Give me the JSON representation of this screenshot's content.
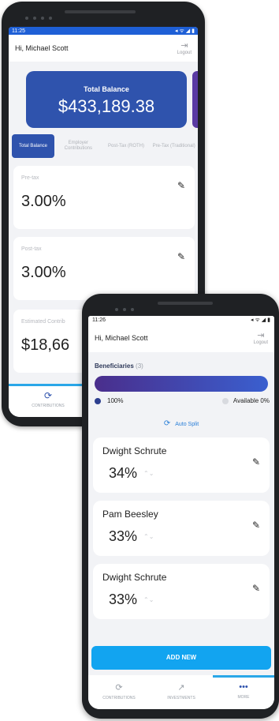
{
  "phone1": {
    "status_time": "11:25",
    "status_icons": "◂ ᯤ ◢ ▮",
    "greeting": "Hi, Michael Scott",
    "logout_label": "Logout",
    "balance_label": "Total Balance",
    "balance_amount": "$433,189.38",
    "tabs": [
      {
        "label": "Total Balance"
      },
      {
        "label": "Employer Contributions"
      },
      {
        "label": "Post-Tax (ROTH)"
      },
      {
        "label": "Pre-Tax (Traditional)"
      }
    ],
    "cards": [
      {
        "label": "Pre-tax",
        "value": "3.00%"
      },
      {
        "label": "Post-tax",
        "value": "3.00%"
      },
      {
        "label": "Estimated Contrib",
        "value": "$18,66"
      }
    ],
    "nav": [
      {
        "label": "CONTRIBUTIONS",
        "icon": "sync-icon"
      }
    ]
  },
  "phone2": {
    "status_time": "11:26",
    "status_icons": "◂ ᯤ ◢ ▮",
    "greeting": "Hi, Michael Scott",
    "logout_label": "Logout",
    "beneficiaries_title": "Beneficiaries",
    "beneficiaries_count": "(3)",
    "allocated_pct": "100%",
    "available_label": "Available 0%",
    "auto_split_label": "Auto Split",
    "beneficiaries": [
      {
        "name": "Dwight Schrute",
        "pct": "34%"
      },
      {
        "name": "Pam Beesley",
        "pct": "33%"
      },
      {
        "name": "Dwight Schrute",
        "pct": "33%"
      }
    ],
    "add_new_label": "ADD NEW",
    "nav": [
      {
        "label": "CONTRIBUTIONS",
        "icon": "sync-icon"
      },
      {
        "label": "INVESTMENTS",
        "icon": "trend-icon"
      },
      {
        "label": "MORE",
        "icon": "more-icon"
      }
    ]
  },
  "colors": {
    "primary": "#2f53ad",
    "accent": "#12a4f0",
    "nav_indicator": "#2aa7e8"
  }
}
